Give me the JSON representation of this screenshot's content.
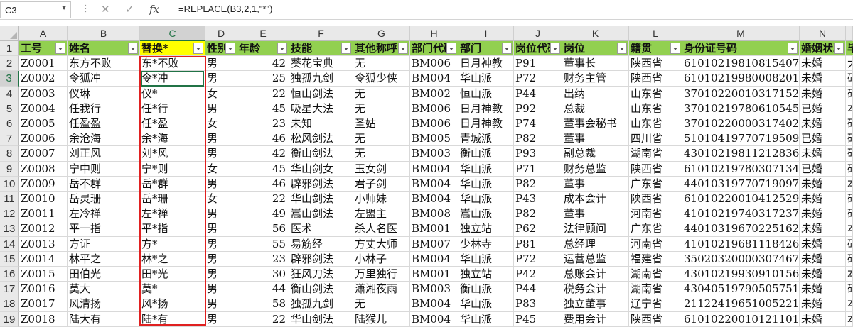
{
  "name_box": "C3",
  "formula": "=REPLACE(B3,2,1,\"*\")",
  "icons": {
    "cancel": "✕",
    "enter": "✓",
    "fx": "fx"
  },
  "columns": [
    "A",
    "B",
    "C",
    "D",
    "E",
    "F",
    "G",
    "H",
    "I",
    "J",
    "K",
    "L",
    "M",
    "N"
  ],
  "selected_column": "C",
  "selected_row": "3",
  "header_row": [
    "工号",
    "姓名",
    "替换*",
    "性别",
    "年龄",
    "技能",
    "其他称呼",
    "部门代码",
    "部门",
    "岗位代码",
    "岗位",
    "籍贯",
    "身份证号码",
    "婚姻状况"
  ],
  "rows": [
    [
      "Z0001",
      "东方不败",
      "东*不败",
      "男",
      "42",
      "葵花宝典",
      "无",
      "BM006",
      "日月神教",
      "P91",
      "董事长",
      "陕西省",
      "610102198108154078",
      "未婚"
    ],
    [
      "Z0002",
      "令狐冲",
      "令*冲",
      "男",
      "25",
      "独孤九剑",
      "令狐少侠",
      "BM004",
      "华山派",
      "P72",
      "财务主管",
      "陕西省",
      "610102199800082016",
      "未婚"
    ],
    [
      "Z0003",
      "仪琳",
      "仪*",
      "女",
      "22",
      "恒山剑法",
      "无",
      "BM002",
      "恒山派",
      "P44",
      "出纳",
      "山东省",
      "370102200103171521",
      "未婚"
    ],
    [
      "Z0004",
      "任我行",
      "任*行",
      "男",
      "45",
      "吸星大法",
      "无",
      "BM006",
      "日月神教",
      "P92",
      "总裁",
      "山东省",
      "370102197806105458",
      "已婚"
    ],
    [
      "Z0005",
      "任盈盈",
      "任*盈",
      "女",
      "23",
      "未知",
      "圣姑",
      "BM006",
      "日月神教",
      "P74",
      "董事会秘书",
      "山东省",
      "370102200003174021",
      "未婚"
    ],
    [
      "Z0006",
      "余沧海",
      "余*海",
      "男",
      "46",
      "松风剑法",
      "无",
      "BM005",
      "青城派",
      "P82",
      "董事",
      "四川省",
      "510104197707195092",
      "已婚"
    ],
    [
      "Z0007",
      "刘正风",
      "刘*风",
      "男",
      "42",
      "衡山剑法",
      "无",
      "BM003",
      "衡山派",
      "P93",
      "副总裁",
      "湖南省",
      "430102198112128366",
      "未婚"
    ],
    [
      "Z0008",
      "宁中则",
      "宁*则",
      "女",
      "45",
      "华山剑女",
      "玉女剑",
      "BM004",
      "华山派",
      "P71",
      "财务总监",
      "陕西省",
      "610102197803071345",
      "已婚"
    ],
    [
      "Z0009",
      "岳不群",
      "岳*群",
      "男",
      "46",
      "辟邪剑法",
      "君子剑",
      "BM004",
      "华山派",
      "P82",
      "董事",
      "广东省",
      "440103197707190976",
      "未婚"
    ],
    [
      "Z0010",
      "岳灵珊",
      "岳*珊",
      "女",
      "22",
      "华山剑法",
      "小师妹",
      "BM004",
      "华山派",
      "P43",
      "成本会计",
      "陕西省",
      "610102200104125299",
      "未婚"
    ],
    [
      "Z0011",
      "左冷禅",
      "左*禅",
      "男",
      "49",
      "嵩山剑法",
      "左盟主",
      "BM008",
      "嵩山派",
      "P82",
      "董事",
      "河南省",
      "410102197403172374",
      "未婚"
    ],
    [
      "Z0012",
      "平一指",
      "平*指",
      "男",
      "56",
      "医术",
      "杀人名医",
      "BM001",
      "独立站",
      "P62",
      "法律顾问",
      "广东省",
      "440103196702251628",
      "未婚"
    ],
    [
      "Z0013",
      "方证",
      "方*",
      "男",
      "55",
      "易筋经",
      "方丈大师",
      "BM007",
      "少林寺",
      "P81",
      "总经理",
      "河南省",
      "410102196811184266",
      "未婚"
    ],
    [
      "Z0014",
      "林平之",
      "林*之",
      "男",
      "23",
      "辟邪剑法",
      "小林子",
      "BM004",
      "华山派",
      "P72",
      "运营总监",
      "福建省",
      "350203200003074678",
      "未婚"
    ],
    [
      "Z0015",
      "田伯光",
      "田*光",
      "男",
      "30",
      "狂风刀法",
      "万里独行",
      "BM001",
      "独立站",
      "P42",
      "总账会计",
      "湖南省",
      "430102199309101566",
      "未婚"
    ],
    [
      "Z0016",
      "莫大",
      "莫*",
      "男",
      "44",
      "衡山剑法",
      "潇湘夜雨",
      "BM003",
      "衡山派",
      "P44",
      "税务会计",
      "湖南省",
      "430405197905057518",
      "未婚"
    ],
    [
      "Z0017",
      "风清扬",
      "风*扬",
      "男",
      "58",
      "独孤九剑",
      "无",
      "BM004",
      "华山派",
      "P83",
      "独立董事",
      "辽宁省",
      "211224196510052218",
      "未婚"
    ],
    [
      "Z0018",
      "陆大有",
      "陆*有",
      "男",
      "22",
      "华山剑法",
      "陆猴儿",
      "BM004",
      "华山派",
      "P45",
      "费用会计",
      "陕西省",
      "610102200101211018",
      "未婚"
    ]
  ],
  "row_numbers": [
    "1",
    "2",
    "3",
    "4",
    "5",
    "6",
    "7",
    "8",
    "9",
    "10",
    "11",
    "12",
    "13",
    "14",
    "15",
    "16",
    "17",
    "18",
    "19"
  ],
  "right_clip_values": [
    "毕",
    "大",
    "研",
    "研",
    "本",
    "研",
    "研",
    "研",
    "研",
    "本",
    "研",
    "研",
    "本",
    "研",
    "研",
    "本",
    "研",
    "本",
    "本"
  ],
  "colors": {
    "header_green": "#92d050",
    "header_yellow": "#ffff00",
    "highlight_red": "#e02020",
    "excel_green": "#217346"
  }
}
